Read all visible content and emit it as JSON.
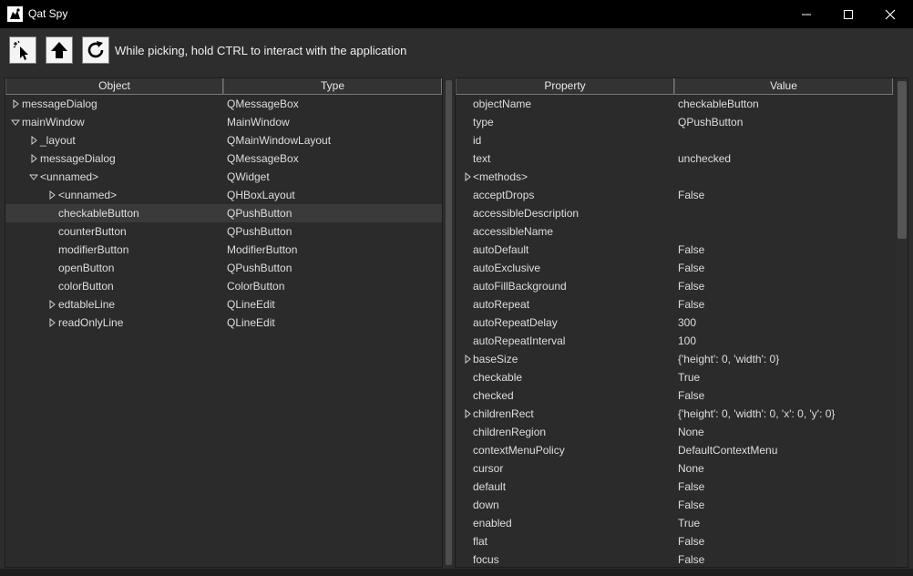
{
  "window": {
    "title": "Qat Spy"
  },
  "toolbar": {
    "hint": "While picking, hold CTRL to interact with the application"
  },
  "objects": {
    "headers": {
      "object": "Object",
      "type": "Type"
    },
    "rows": [
      {
        "name": "messageDialog",
        "type": "QMessageBox",
        "level": 0,
        "arrow": "closed",
        "selected": false
      },
      {
        "name": "mainWindow",
        "type": "MainWindow",
        "level": 0,
        "arrow": "open",
        "selected": false
      },
      {
        "name": "_layout",
        "type": "QMainWindowLayout",
        "level": 1,
        "arrow": "closed",
        "selected": false
      },
      {
        "name": "messageDialog",
        "type": "QMessageBox",
        "level": 1,
        "arrow": "closed",
        "selected": false
      },
      {
        "name": "<unnamed>",
        "type": "QWidget",
        "level": 1,
        "arrow": "open",
        "selected": false
      },
      {
        "name": "<unnamed>",
        "type": "QHBoxLayout",
        "level": 2,
        "arrow": "closed",
        "selected": false
      },
      {
        "name": "checkableButton",
        "type": "QPushButton",
        "level": 2,
        "arrow": "none",
        "selected": true
      },
      {
        "name": "counterButton",
        "type": "QPushButton",
        "level": 2,
        "arrow": "none",
        "selected": false
      },
      {
        "name": "modifierButton",
        "type": "ModifierButton",
        "level": 2,
        "arrow": "none",
        "selected": false
      },
      {
        "name": "openButton",
        "type": "QPushButton",
        "level": 2,
        "arrow": "none",
        "selected": false
      },
      {
        "name": "colorButton",
        "type": "ColorButton",
        "level": 2,
        "arrow": "none",
        "selected": false
      },
      {
        "name": "edtableLine",
        "type": "QLineEdit",
        "level": 2,
        "arrow": "closed",
        "selected": false
      },
      {
        "name": "readOnlyLine",
        "type": "QLineEdit",
        "level": 2,
        "arrow": "closed",
        "selected": false
      }
    ]
  },
  "properties": {
    "headers": {
      "property": "Property",
      "value": "Value"
    },
    "rows": [
      {
        "name": "objectName",
        "value": "checkableButton",
        "expandable": false
      },
      {
        "name": "type",
        "value": "QPushButton",
        "expandable": false
      },
      {
        "name": "id",
        "value": "",
        "expandable": false
      },
      {
        "name": "text",
        "value": "unchecked",
        "expandable": false
      },
      {
        "name": "<methods>",
        "value": "",
        "expandable": true
      },
      {
        "name": "acceptDrops",
        "value": "False",
        "expandable": false
      },
      {
        "name": "accessibleDescription",
        "value": "",
        "expandable": false
      },
      {
        "name": "accessibleName",
        "value": "",
        "expandable": false
      },
      {
        "name": "autoDefault",
        "value": "False",
        "expandable": false
      },
      {
        "name": "autoExclusive",
        "value": "False",
        "expandable": false
      },
      {
        "name": "autoFillBackground",
        "value": "False",
        "expandable": false
      },
      {
        "name": "autoRepeat",
        "value": "False",
        "expandable": false
      },
      {
        "name": "autoRepeatDelay",
        "value": "300",
        "expandable": false
      },
      {
        "name": "autoRepeatInterval",
        "value": "100",
        "expandable": false
      },
      {
        "name": "baseSize",
        "value": "{'height': 0, 'width': 0}",
        "expandable": true
      },
      {
        "name": "checkable",
        "value": "True",
        "expandable": false
      },
      {
        "name": "checked",
        "value": "False",
        "expandable": false
      },
      {
        "name": "childrenRect",
        "value": "{'height': 0, 'width': 0, 'x': 0, 'y': 0}",
        "expandable": true
      },
      {
        "name": "childrenRegion",
        "value": "None",
        "expandable": false
      },
      {
        "name": "contextMenuPolicy",
        "value": "DefaultContextMenu",
        "expandable": false
      },
      {
        "name": "cursor",
        "value": "None",
        "expandable": false
      },
      {
        "name": "default",
        "value": "False",
        "expandable": false
      },
      {
        "name": "down",
        "value": "False",
        "expandable": false
      },
      {
        "name": "enabled",
        "value": "True",
        "expandable": false
      },
      {
        "name": "flat",
        "value": "False",
        "expandable": false
      },
      {
        "name": "focus",
        "value": "False",
        "expandable": false
      }
    ]
  }
}
